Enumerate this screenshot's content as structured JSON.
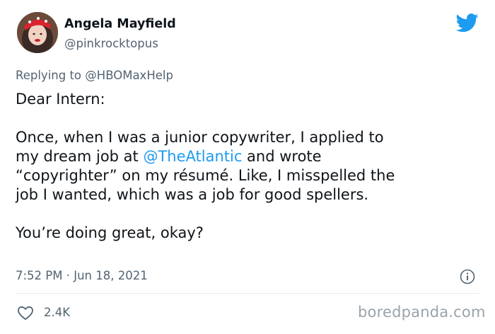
{
  "tweet": {
    "author_name": "Angela Mayfield",
    "author_handle": "@pinkrocktopus",
    "replying_prefix": "Replying to",
    "replying_handle": "@HBOMaxHelp",
    "lines": {
      "l1": "Dear Intern:",
      "l2": "Once, when I was a junior copywriter, I applied to",
      "l3_before": "my dream job at ",
      "l3_mention": "@TheAtlantic",
      "l3_after": " and wrote",
      "l4": "“copyrighter” on my résumé. Like, I misspelled the",
      "l5": "job I wanted, which was a job for good spellers.",
      "l6": "You’re doing great, okay?"
    },
    "timestamp": "7:52 PM · Jun 18, 2021",
    "likes": "2.4K"
  },
  "watermark": "boredpanda.com",
  "icons": {
    "platform": "twitter-bird-icon",
    "info": "info-icon",
    "like": "heart-icon"
  },
  "colors": {
    "accent": "#1d9bf0",
    "text": "#0f1419",
    "muted": "#536471"
  }
}
